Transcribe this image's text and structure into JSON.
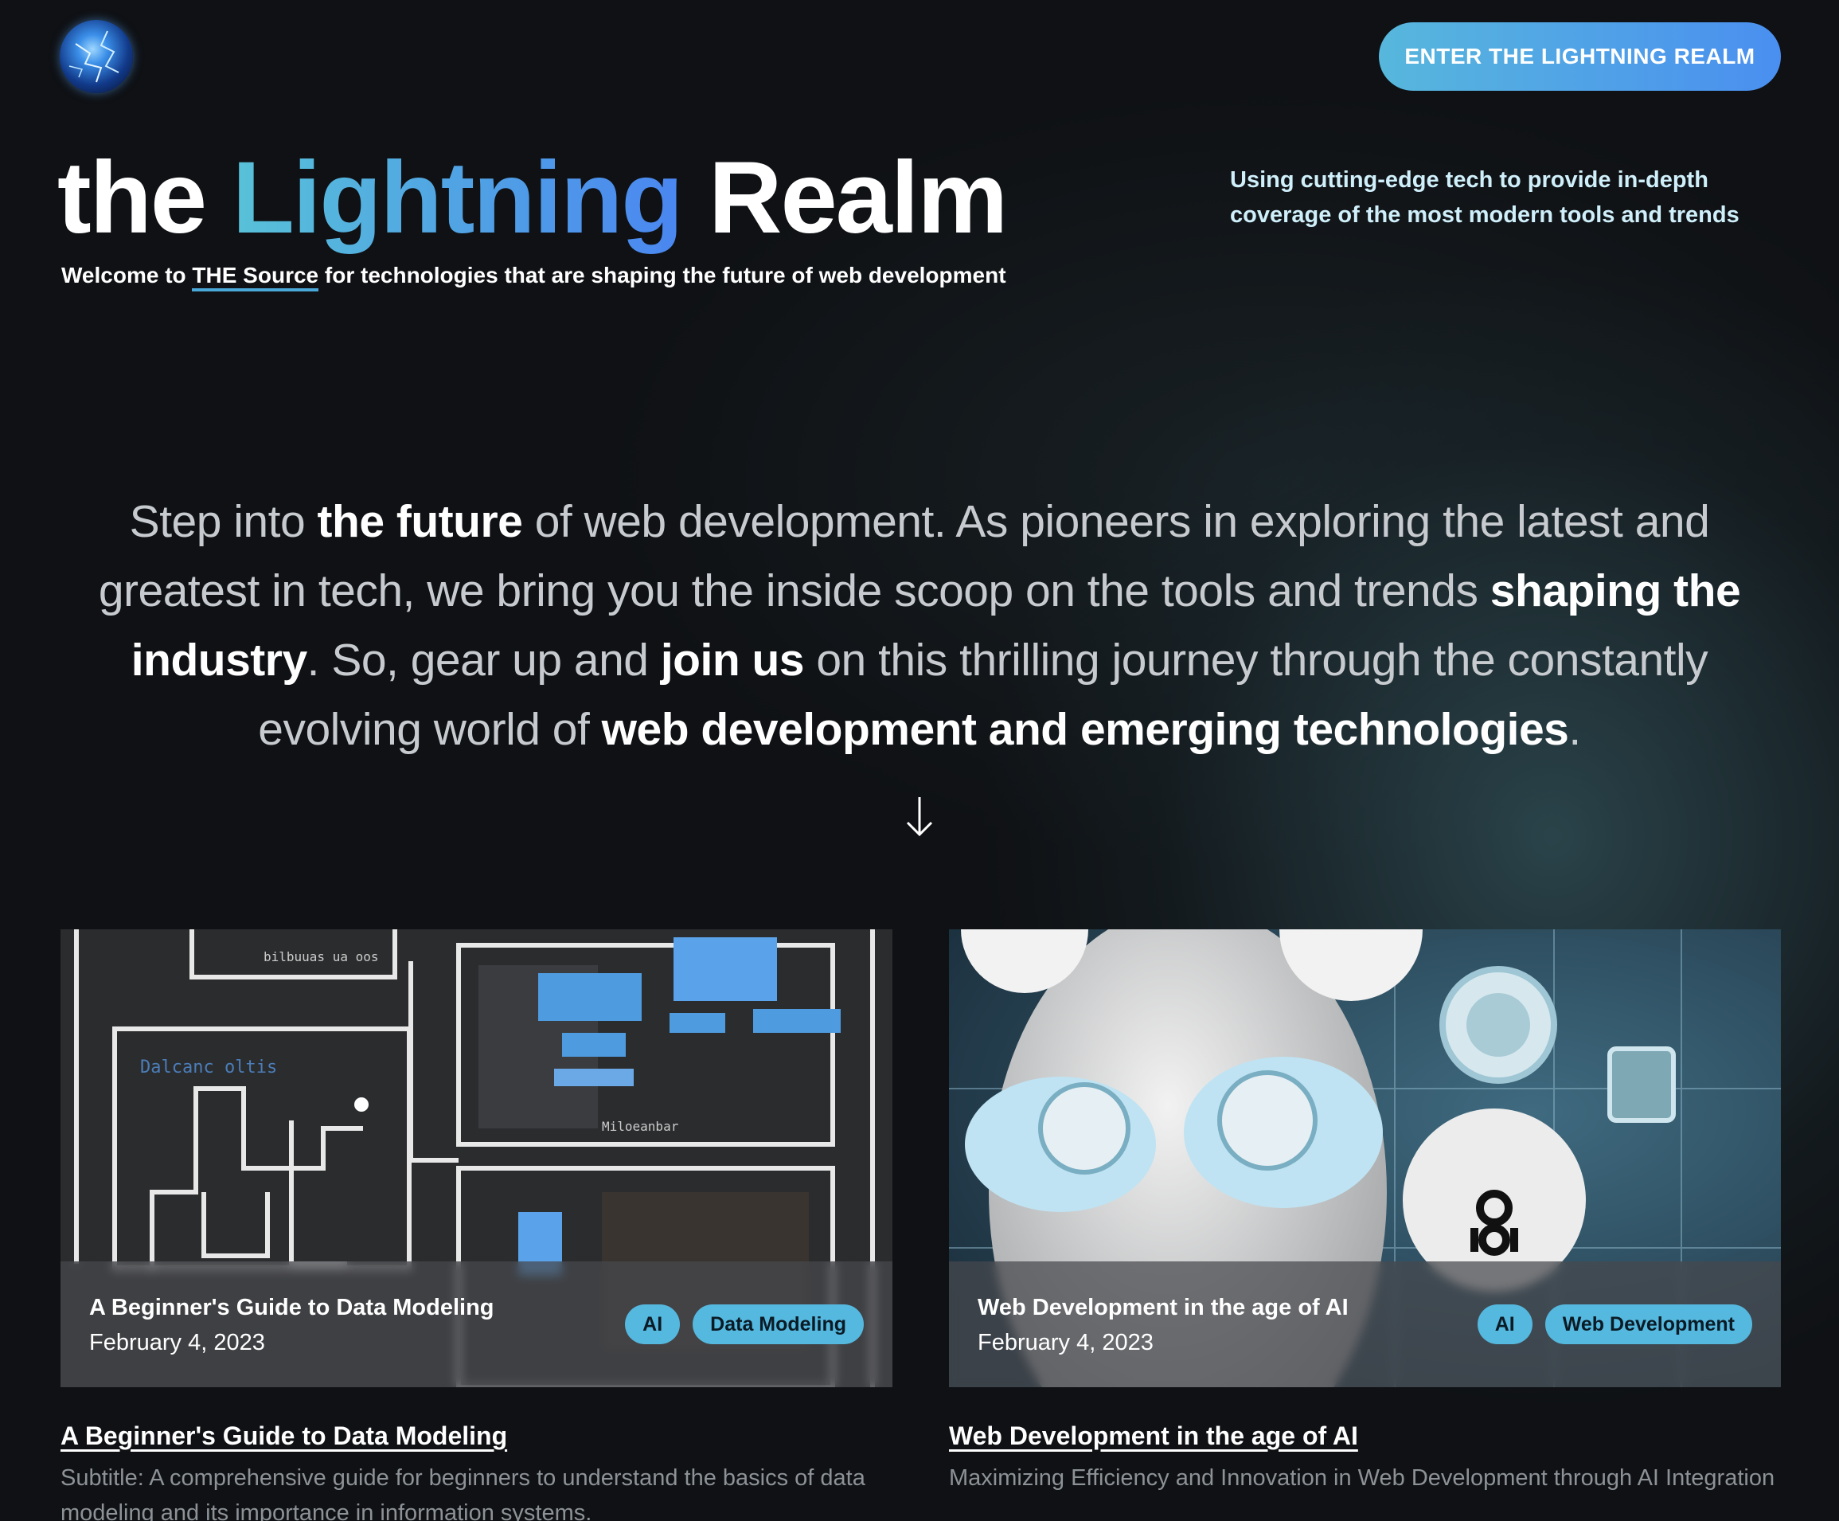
{
  "header": {
    "logo_alt": "Lightning globe logo",
    "enter_button": "ENTER THE LIGHTNING REALM"
  },
  "hero": {
    "title_pre": "the",
    "title_accent": "Lightning",
    "title_post": "Realm",
    "welcome_pre": "Welcome to",
    "welcome_link": "THE Source",
    "welcome_post": "for technologies that are shaping the future of web development",
    "tagline": "Using cutting-edge tech to provide in-depth coverage of the most modern tools and trends"
  },
  "intro": {
    "p1": "Step into",
    "b1": "the future",
    "p2": "of web development. As pioneers in exploring the latest and greatest in tech, we bring you the inside scoop on the tools and trends",
    "b2": "shaping the industry",
    "p3": ". So, gear up and",
    "b3": "join us",
    "p4": "on this thrilling journey through the constantly evolving world of",
    "b4": "web development and emerging technologies",
    "p5": "."
  },
  "posts": [
    {
      "overlay_title": "A Beginner's Guide to Data Modeling",
      "date": "February 4, 2023",
      "tags": [
        "AI",
        "Data Modeling"
      ],
      "title": "A Beginner's Guide to Data Modeling",
      "subtitle": "Subtitle: A comprehensive guide for beginners to understand the basics of data modeling and its importance in information systems."
    },
    {
      "overlay_title": "Web Development in the age of AI",
      "date": "February 4, 2023",
      "tags": [
        "AI",
        "Web Development"
      ],
      "title": "Web Development in the age of AI",
      "subtitle": "Maximizing Efficiency and Innovation in Web Development through AI Integration"
    }
  ],
  "colors": {
    "background": "#0f1114",
    "accent_start": "#58c1d8",
    "accent_end": "#4a86f0",
    "tag_bg": "#55b8df"
  }
}
